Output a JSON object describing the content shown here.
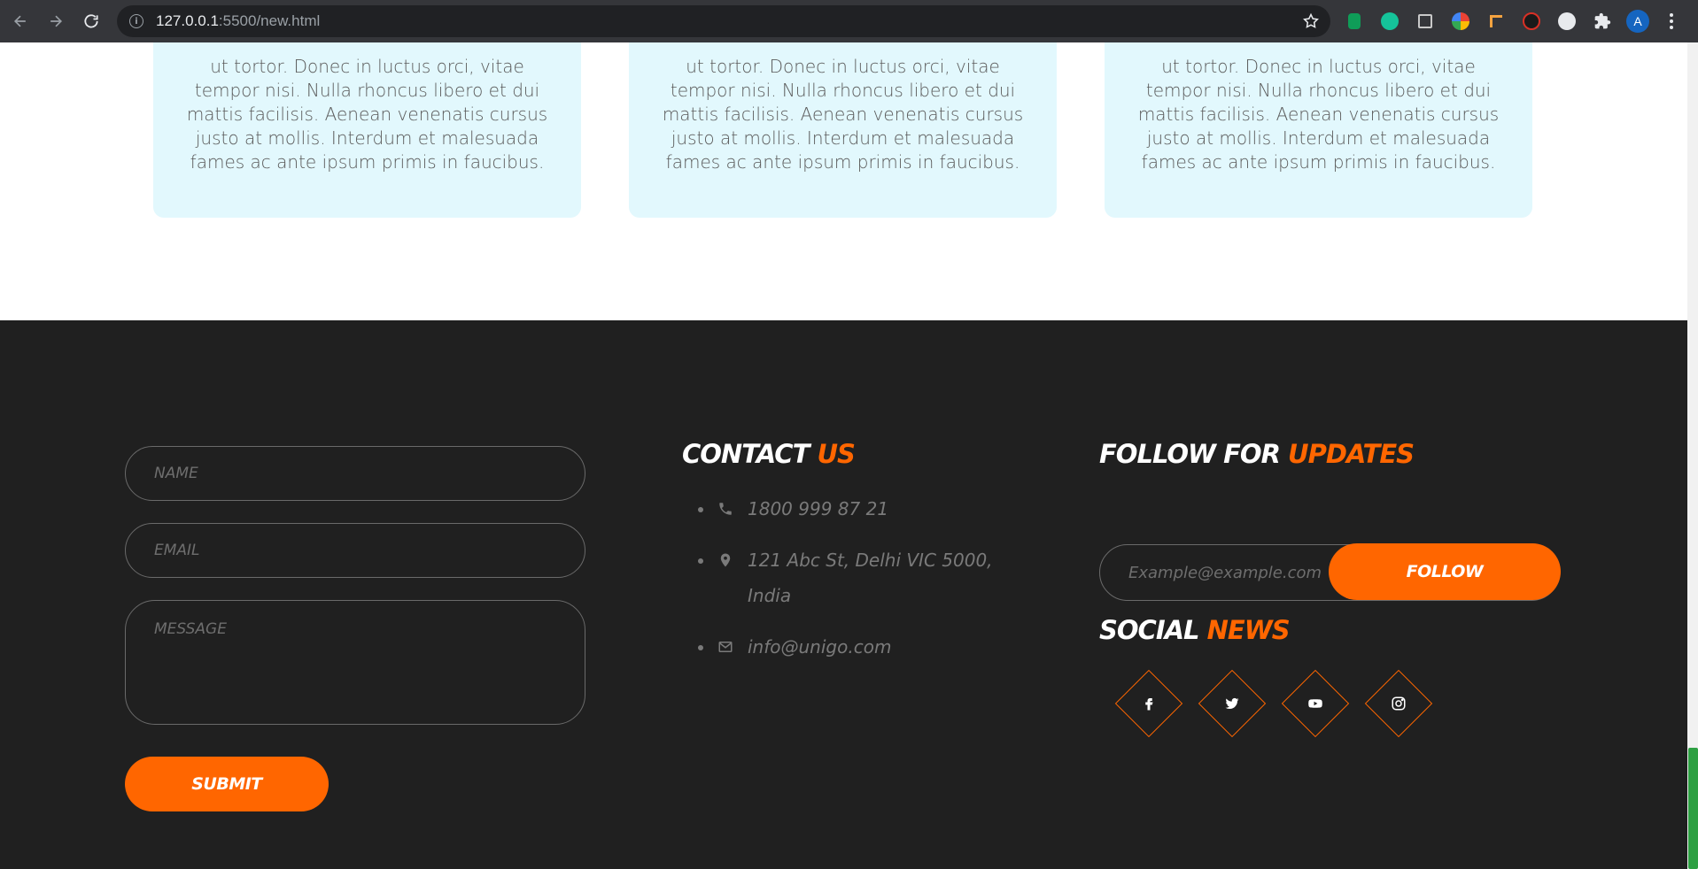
{
  "browser": {
    "url_host": "127.0.0.1",
    "url_path": ":5500/new.html",
    "avatar_letter": "A"
  },
  "cards": [
    {
      "text": "ut tortor. Donec in luctus orci, vitae tempor nisi. Nulla rhoncus libero et dui mattis facilisis. Aenean venenatis cursus justo at mollis. Interdum et malesuada fames ac ante ipsum primis in faucibus."
    },
    {
      "text": "ut tortor. Donec in luctus orci, vitae tempor nisi. Nulla rhoncus libero et dui mattis facilisis. Aenean venenatis cursus justo at mollis. Interdum et malesuada fames ac ante ipsum primis in faucibus."
    },
    {
      "text": "ut tortor. Donec in luctus orci, vitae tempor nisi. Nulla rhoncus libero et dui mattis facilisis. Aenean venenatis cursus justo at mollis. Interdum et malesuada fames ac ante ipsum primis in faucibus."
    }
  ],
  "form": {
    "name_placeholder": "NAME",
    "email_placeholder": "EMAIL",
    "message_placeholder": "MESSAGE",
    "submit_label": "SUBMIT"
  },
  "contact": {
    "title_main": "CONTACT ",
    "title_accent": "US",
    "phone": "1800 999 87 21",
    "address": "121 Abc St, Delhi VIC 5000, India",
    "email": "info@unigo.com"
  },
  "follow": {
    "title_main": "FOLLOW FOR ",
    "title_accent": "UPDATES",
    "email_placeholder": "Example@example.com",
    "button_label": "FOLLOW"
  },
  "social": {
    "title_main": "SOCIAL ",
    "title_accent": "NEWS",
    "icons": [
      "facebook-icon",
      "twitter-icon",
      "youtube-icon",
      "instagram-icon"
    ]
  },
  "colors": {
    "accent": "#ff6600",
    "footer_bg": "#202020",
    "card_bg": "#e2f8fd"
  }
}
